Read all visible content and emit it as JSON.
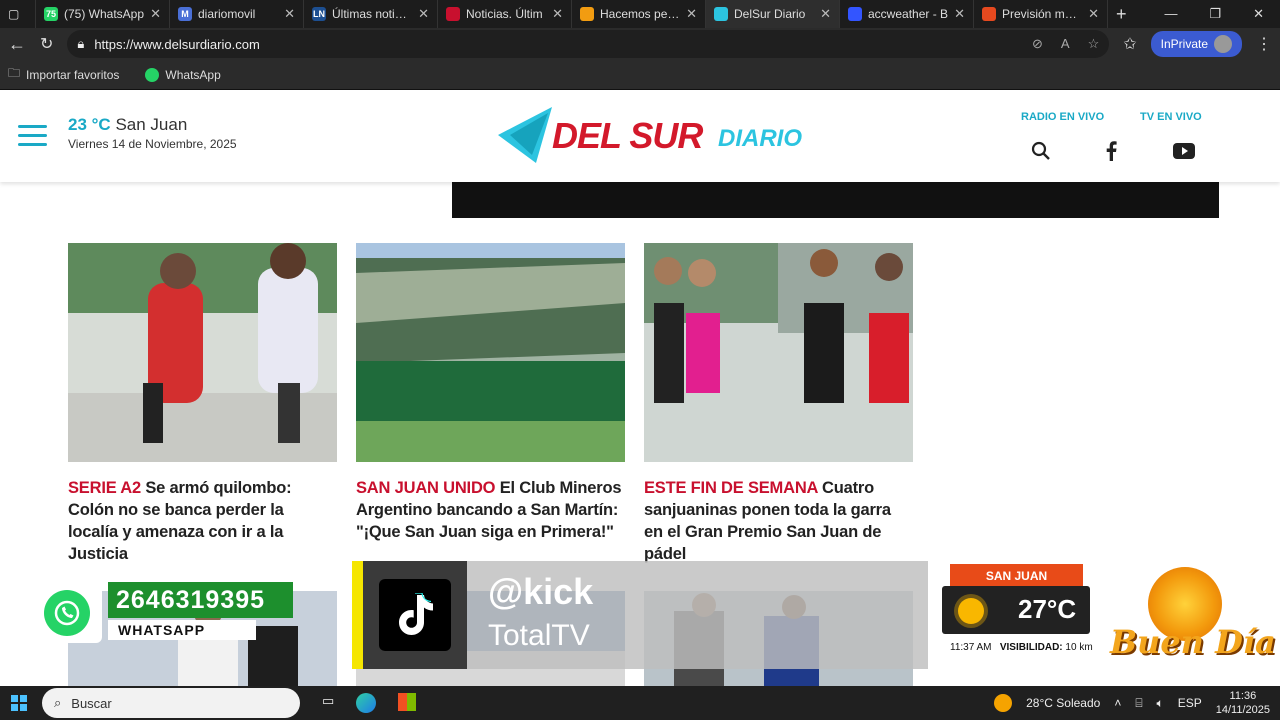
{
  "browser": {
    "tabs": [
      {
        "title": "(75) WhatsApp",
        "fav_color": "#25d366",
        "fav_text": "75"
      },
      {
        "title": "diariomovil",
        "fav_color": "#4a6fd6",
        "fav_text": "M"
      },
      {
        "title": "Últimas noticias",
        "fav_color": "#1d4f91",
        "fav_text": "LN"
      },
      {
        "title": "Noticias. Últim",
        "fav_color": "#c8102e",
        "fav_text": ""
      },
      {
        "title": "Hacemos periodismo",
        "fav_color": "#f29c11",
        "fav_text": ""
      },
      {
        "title": "DelSur Diario",
        "fav_color": "#2cc4e0",
        "fav_text": ""
      },
      {
        "title": "accweather - B",
        "fav_color": "#3355ff",
        "fav_text": ""
      },
      {
        "title": "Previsión meteo",
        "fav_color": "#e6491f",
        "fav_text": ""
      }
    ],
    "url": "https://www.delsurdiario.com",
    "inprivate_label": "InPrivate",
    "favorites": [
      {
        "label": "Importar favoritos",
        "icon": "folder-icon"
      },
      {
        "label": "WhatsApp",
        "icon": "whatsapp-icon"
      }
    ]
  },
  "header": {
    "temperature": "23 °C",
    "city": "San Juan",
    "date": "Viernes 14 de Noviembre, 2025",
    "logo_main": "DEL SUR",
    "logo_sub": "DIARIO",
    "radio_label": "RADIO EN VIVO",
    "tv_label": "TV EN VIVO",
    "accent_color": "#1aa9c6",
    "brand_red": "#d3192b"
  },
  "articles": [
    {
      "kicker": "SERIE A2",
      "title": "Se armó quilombo: Colón no se banca perder la localía y amenaza con ir a la Justicia"
    },
    {
      "kicker": "SAN JUAN UNIDO",
      "title": "El Club Mineros Argentino bancando a San Martín: \"¡Que San Juan siga en Primera!\""
    },
    {
      "kicker": "ESTE FIN DE SEMANA",
      "title": "Cuatro sanjuaninas ponen toda la garra en el Gran Premio San Juan de pádel"
    }
  ],
  "overlays": {
    "whatsapp_number": "2646319395",
    "whatsapp_label": "WHATSAPP",
    "kick_handle": "@kick",
    "kick_sub": "TotalTV",
    "weather_city": "SAN JUAN",
    "weather_temp": "27°C",
    "weather_time": "11:37 AM",
    "weather_visibility_label": "VISIBILIDAD:",
    "weather_visibility_value": "10 km",
    "buen_dia": "Buen Día"
  },
  "taskbar": {
    "search_placeholder": "Buscar",
    "weather": "28°C Soleado",
    "lang": "ESP",
    "time": "11:36",
    "date": "14/11/2025"
  }
}
